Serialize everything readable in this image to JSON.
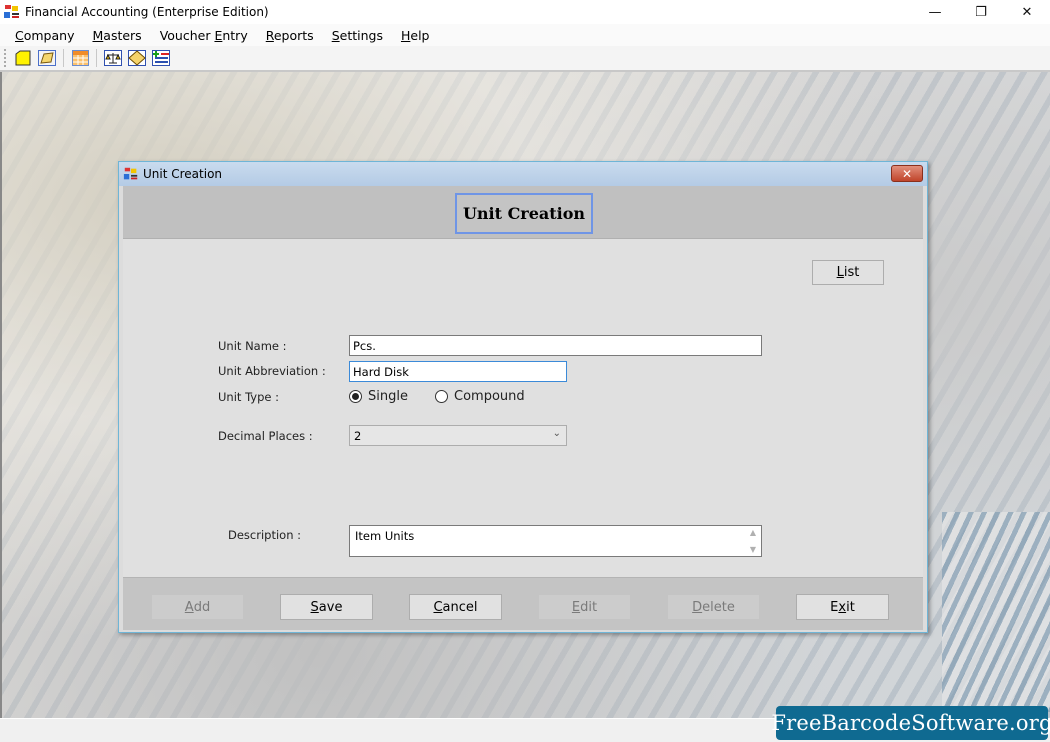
{
  "window": {
    "title": "Financial Accounting (Enterprise Edition)",
    "controls": {
      "minimize": "—",
      "restore": "❐",
      "close": "✕"
    }
  },
  "menu": [
    {
      "pre": "",
      "ul": "C",
      "post": "ompany"
    },
    {
      "pre": "",
      "ul": "M",
      "post": "asters"
    },
    {
      "pre": "Voucher ",
      "ul": "E",
      "post": "ntry"
    },
    {
      "pre": "",
      "ul": "R",
      "post": "eports"
    },
    {
      "pre": "",
      "ul": "S",
      "post": "ettings"
    },
    {
      "pre": "",
      "ul": "H",
      "post": "elp"
    }
  ],
  "toolbar": {
    "icons": [
      "new-company-icon",
      "open-company-icon",
      "grid-table-icon",
      "balance-scale-icon",
      "ledger-icon",
      "add-voucher-icon"
    ]
  },
  "dialog": {
    "title": "Unit Creation",
    "close_glyph": "✕",
    "header_title": "Unit Creation",
    "list_button": {
      "ul": "L",
      "post": "ist"
    },
    "form": {
      "unit_name_label": "Unit Name :",
      "unit_name_value": "Pcs.",
      "unit_abbr_label": "Unit Abbreviation :",
      "unit_abbr_value": "Hard Disk",
      "unit_type_label": "Unit Type :",
      "unit_type_options": [
        "Single",
        "Compound"
      ],
      "unit_type_selected": "Single",
      "decimal_label": "Decimal Places :",
      "decimal_value": "2",
      "description_label": "Description :",
      "description_value": "Item Units"
    },
    "buttons": [
      {
        "key": "add",
        "pre": "",
        "ul": "A",
        "post": "dd",
        "enabled": false
      },
      {
        "key": "save",
        "pre": "",
        "ul": "S",
        "post": "ave",
        "enabled": true
      },
      {
        "key": "cancel",
        "pre": "",
        "ul": "C",
        "post": "ancel",
        "enabled": true
      },
      {
        "key": "edit",
        "pre": "",
        "ul": "E",
        "post": "dit",
        "enabled": false
      },
      {
        "key": "delete",
        "pre": "",
        "ul": "D",
        "post": "elete",
        "enabled": false
      },
      {
        "key": "exit",
        "pre": "E",
        "ul": "x",
        "post": "it",
        "enabled": true
      }
    ]
  },
  "watermark": "FreeBarcodeSoftware.org",
  "colors": {
    "watermark_bg": "#0f6a91",
    "header_focus_border": "#6f95e6",
    "dialog_title_bg": "#b4cbe5",
    "close_button": "#c0452b"
  }
}
